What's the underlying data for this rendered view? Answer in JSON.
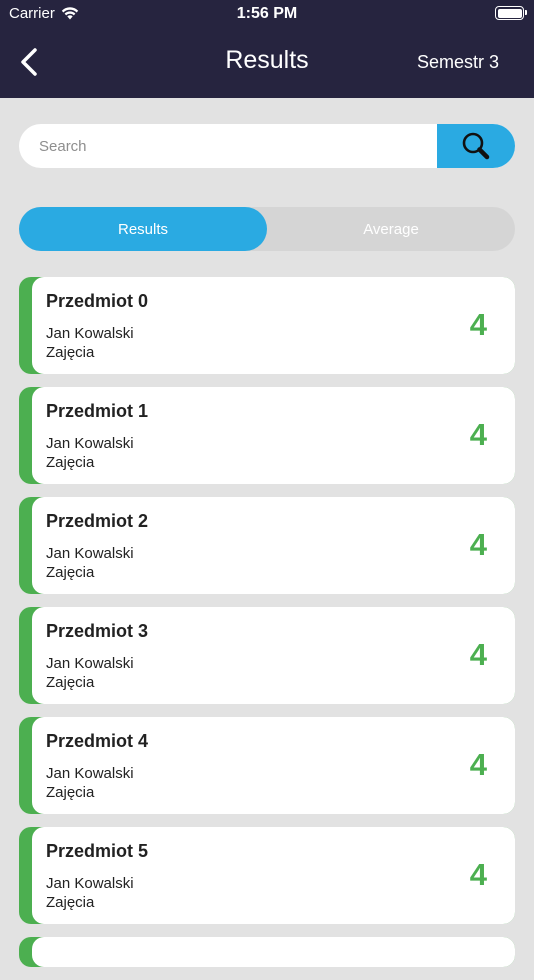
{
  "status_bar": {
    "carrier": "Carrier",
    "time": "1:56 PM"
  },
  "nav": {
    "title": "Results",
    "right": "Semestr 3"
  },
  "search": {
    "placeholder": "Search",
    "value": ""
  },
  "tabs": [
    {
      "label": "Results",
      "active": true
    },
    {
      "label": "Average",
      "active": false
    }
  ],
  "colors": {
    "header": "#26243f",
    "accent": "#2aaae2",
    "grade": "#4caf50",
    "background": "#e2e2e2"
  },
  "results": [
    {
      "subject": "Przedmiot 0",
      "teacher": "Jan Kowalski",
      "type": "Zajęcia",
      "grade": "4"
    },
    {
      "subject": "Przedmiot 1",
      "teacher": "Jan Kowalski",
      "type": "Zajęcia",
      "grade": "4"
    },
    {
      "subject": "Przedmiot 2",
      "teacher": "Jan Kowalski",
      "type": "Zajęcia",
      "grade": "4"
    },
    {
      "subject": "Przedmiot 3",
      "teacher": "Jan Kowalski",
      "type": "Zajęcia",
      "grade": "4"
    },
    {
      "subject": "Przedmiot 4",
      "teacher": "Jan Kowalski",
      "type": "Zajęcia",
      "grade": "4"
    },
    {
      "subject": "Przedmiot 5",
      "teacher": "Jan Kowalski",
      "type": "Zajęcia",
      "grade": "4"
    }
  ]
}
